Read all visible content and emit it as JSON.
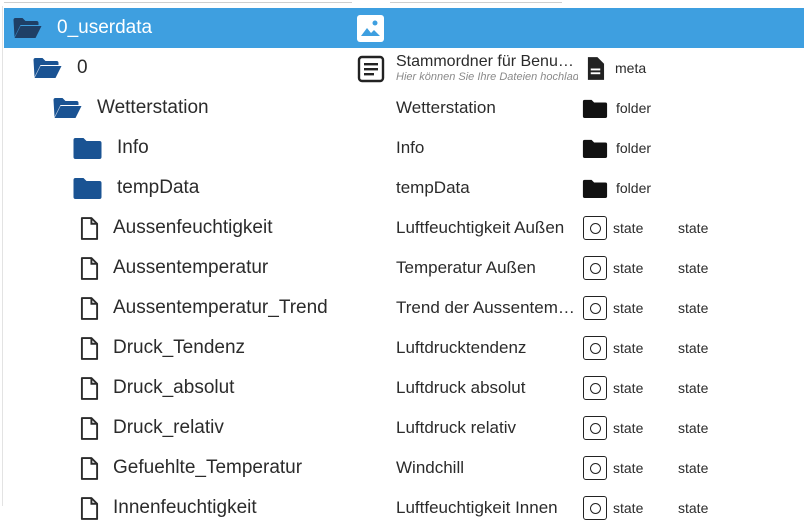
{
  "colors": {
    "selection": "#3e9fe0",
    "folder": "#1a5393",
    "text": "#2b2b2b"
  },
  "rows": [
    {
      "name": "0_userdata",
      "icon": "folder-open-icon",
      "selected": true,
      "indent": 0
    },
    {
      "name": "0",
      "icon": "folder-open-icon",
      "indent": 1,
      "desc": "Stammordner für Benutzerobjekte und Dateien",
      "desc_sub": "Hier können Sie Ihre Dateien hochladen",
      "type": "meta",
      "type_icon": "file-icon"
    },
    {
      "name": "Wetterstation",
      "icon": "folder-open-icon",
      "indent": 2,
      "desc": "Wetterstation",
      "type": "folder",
      "type_icon": "folder-icon"
    },
    {
      "name": "Info",
      "icon": "folder-icon",
      "indent": 3,
      "desc": "Info",
      "type": "folder",
      "type_icon": "folder-icon"
    },
    {
      "name": "tempData",
      "icon": "folder-icon",
      "indent": 3,
      "desc": "tempData",
      "type": "folder",
      "type_icon": "folder-icon"
    },
    {
      "name": "Aussenfeuchtigkeit",
      "icon": "file-icon",
      "indent": 3,
      "desc": "Luftfeuchtigkeit Außen",
      "type": "state",
      "type_icon": "state-icon",
      "role": "state"
    },
    {
      "name": "Aussentemperatur",
      "icon": "file-icon",
      "indent": 3,
      "desc": "Temperatur Außen",
      "type": "state",
      "type_icon": "state-icon",
      "role": "state"
    },
    {
      "name": "Aussentemperatur_Trend",
      "icon": "file-icon",
      "indent": 3,
      "desc": "Trend der Aussentemperatur",
      "type": "state",
      "type_icon": "state-icon",
      "role": "state"
    },
    {
      "name": "Druck_Tendenz",
      "icon": "file-icon",
      "indent": 3,
      "desc": "Luftdrucktendenz",
      "type": "state",
      "type_icon": "state-icon",
      "role": "state"
    },
    {
      "name": "Druck_absolut",
      "icon": "file-icon",
      "indent": 3,
      "desc": "Luftdruck absolut",
      "type": "state",
      "type_icon": "state-icon",
      "role": "state"
    },
    {
      "name": "Druck_relativ",
      "icon": "file-icon",
      "indent": 3,
      "desc": "Luftdruck relativ",
      "type": "state",
      "type_icon": "state-icon",
      "role": "state"
    },
    {
      "name": "Gefuehlte_Temperatur",
      "icon": "file-icon",
      "indent": 3,
      "desc": "Windchill",
      "type": "state",
      "type_icon": "state-icon",
      "role": "state"
    },
    {
      "name": "Innenfeuchtigkeit",
      "icon": "file-icon",
      "indent": 3,
      "desc": "Luftfeuchtigkeit Innen",
      "type": "state",
      "type_icon": "state-icon",
      "role": "state"
    }
  ]
}
